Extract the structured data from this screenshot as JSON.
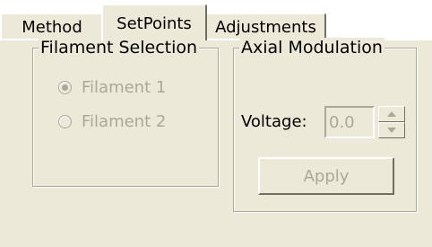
{
  "tabs": [
    {
      "label": "Method",
      "active": false
    },
    {
      "label": "SetPoints",
      "active": true
    },
    {
      "label": "Adjustments",
      "active": false
    }
  ],
  "filament_group": {
    "title": "Filament Selection",
    "options": [
      {
        "label": "Filament 1",
        "checked": true,
        "enabled": false
      },
      {
        "label": "Filament 2",
        "checked": false,
        "enabled": false
      }
    ]
  },
  "axial_group": {
    "title": "Axial Modulation",
    "voltage_label": "Voltage:",
    "voltage_value": "0.0",
    "apply_label": "Apply"
  },
  "colors": {
    "background": "#ece9d8",
    "disabled_text": "#aca899",
    "shadow": "#716f64"
  }
}
